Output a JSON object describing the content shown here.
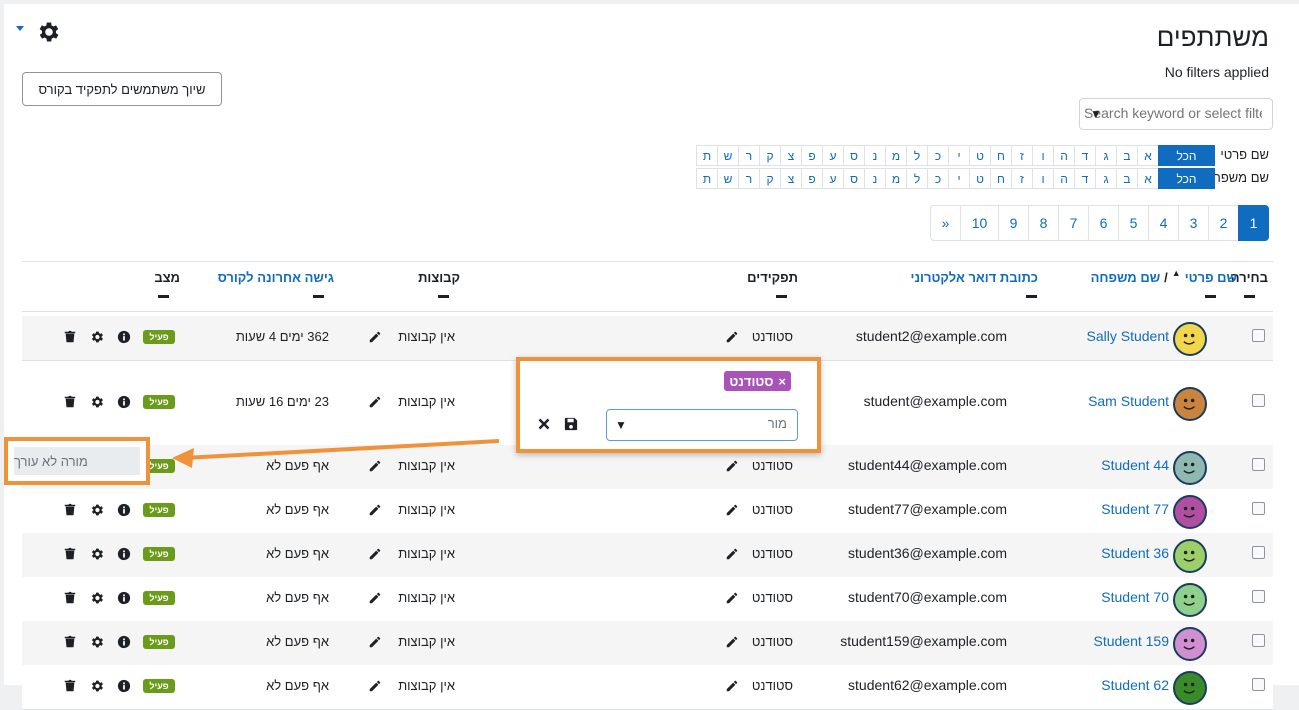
{
  "page": {
    "title": "משתתפים",
    "filter_status": "No filters applied",
    "enrol_button": "שיוך משתמשים לתפקיד בקורס",
    "search_placeholder": "Search keyword or select filter"
  },
  "initials": {
    "first_label": "שם פרטי",
    "last_label": "שם משפחה",
    "all": "הכל",
    "letters": [
      "א",
      "ב",
      "ג",
      "ד",
      "ה",
      "ו",
      "ז",
      "ח",
      "ט",
      "י",
      "כ",
      "ל",
      "מ",
      "נ",
      "ס",
      "ע",
      "פ",
      "צ",
      "ק",
      "ר",
      "ש",
      "ת"
    ]
  },
  "pagination": {
    "pages": [
      "1",
      "2",
      "3",
      "4",
      "5",
      "6",
      "7",
      "8",
      "9",
      "10",
      "»"
    ]
  },
  "table": {
    "headers": {
      "select": "בחירה",
      "firstname": "שם פרטי",
      "separator": "/",
      "lastname": "שם משפחה",
      "email": "כתובת דואר אלקטרוני",
      "roles": "תפקידים",
      "groups": "קבוצות",
      "lastaccess": "גישה אחרונה לקורס",
      "status": "מצב"
    },
    "rows": [
      {
        "name": "Sally Student",
        "email": "student2@example.com",
        "role": "סטודנט",
        "groups": "אין קבוצות",
        "access": "362 ימים 4 שעות",
        "status": "פעיל",
        "avatar_color": "#f2d64b"
      },
      {
        "name": "Sam Student",
        "email": "student@example.com",
        "role": "",
        "groups": "אין קבוצות",
        "access": "23 ימים 16 שעות",
        "status": "פעיל",
        "avatar_color": "#c9853f"
      },
      {
        "name": "Student 44",
        "email": "student44@example.com",
        "role": "סטודנט",
        "groups": "אין קבוצות",
        "access": "אף פעם לא",
        "status": "פעיל",
        "avatar_color": "#8fb8b0"
      },
      {
        "name": "Student 77",
        "email": "student77@example.com",
        "role": "סטודנט",
        "groups": "אין קבוצות",
        "access": "אף פעם לא",
        "status": "פעיל",
        "avatar_color": "#b04fa0"
      },
      {
        "name": "Student 36",
        "email": "student36@example.com",
        "role": "סטודנט",
        "groups": "אין קבוצות",
        "access": "אף פעם לא",
        "status": "פעיל",
        "avatar_color": "#9ccf6a"
      },
      {
        "name": "Student 70",
        "email": "student70@example.com",
        "role": "סטודנט",
        "groups": "אין קבוצות",
        "access": "אף פעם לא",
        "status": "פעיל",
        "avatar_color": "#8fd08a"
      },
      {
        "name": "Student 159",
        "email": "student159@example.com",
        "role": "סטודנט",
        "groups": "אין קבוצות",
        "access": "אף פעם לא",
        "status": "פעיל",
        "avatar_color": "#d08fd0"
      },
      {
        "name": "Student 62",
        "email": "student62@example.com",
        "role": "סטודנט",
        "groups": "אין קבוצות",
        "access": "אף פעם לא",
        "status": "פעיל",
        "avatar_color": "#3a8a2a"
      }
    ]
  },
  "role_editor": {
    "tag": "סטודנט",
    "input_value": "מור",
    "suggestion": "מורה לא עורך"
  },
  "colors": {
    "link": "#0f6cbf",
    "accent_orange": "#f0923a",
    "badge_green": "#6b9b1a",
    "tag_purple": "#a853b8"
  }
}
